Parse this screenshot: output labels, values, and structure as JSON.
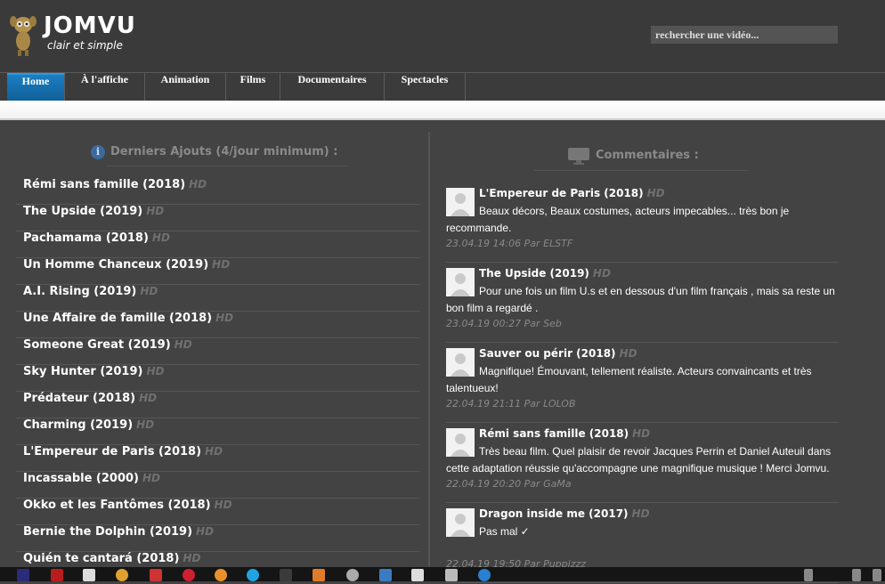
{
  "header": {
    "title": "JOMVU",
    "tagline": "clair et simple",
    "search_placeholder": "rechercher une vidéo..."
  },
  "nav": {
    "items": [
      "Home",
      "À l'affiche",
      "Animation",
      "Films",
      "Documentaires",
      "Spectacles"
    ],
    "active": "Home"
  },
  "latest": {
    "heading": "Derniers Ajouts (4/jour minimum) :",
    "badge": "HD",
    "items": [
      "Rémi sans famille (2018)",
      "The Upside (2019)",
      "Pachamama (2018)",
      "Un Homme Chanceux (2019)",
      "A.I. Rising (2019)",
      "Une Affaire de famille (2018)",
      "Someone Great (2019)",
      "Sky Hunter (2019)",
      "Prédateur (2018)",
      "Charming (2019)",
      "L'Empereur de Paris (2018)",
      "Incassable (2000)",
      "Okko et les Fantômes (2018)",
      "Bernie the Dolphin (2019)",
      "Quién te cantará (2018)"
    ]
  },
  "comments": {
    "heading": "Commentaires :",
    "badge": "HD",
    "items": [
      {
        "title": "L'Empereur de Paris (2018)",
        "text": "Beaux décors, Beaux costumes, acteurs impecables... très bon je recommande.",
        "meta": "23.04.19 14:06 Par ELSTF"
      },
      {
        "title": "The Upside (2019)",
        "text": "Pour une fois un film U.s et en dessous d'un film français , mais sa reste un bon film a regardé .",
        "meta": "23.04.19 00:27 Par Seb"
      },
      {
        "title": "Sauver ou périr (2018)",
        "text": "Magnifique! Émouvant, tellement réaliste. Acteurs convaincants et très talentueux!",
        "meta": "22.04.19 21:11 Par LOLOB"
      },
      {
        "title": "Rémi sans famille (2018)",
        "text": "Très beau film. Quel plaisir de revoir Jacques Perrin et Daniel Auteuil dans cette adaptation réussie qu'accompagne une magnifique musique ! Merci Jomvu.",
        "meta": "22.04.19 20:20 Par GaMa"
      },
      {
        "title": "Dragon inside me (2017)",
        "text": "Pas mal ✓",
        "meta": "22.04.19 19:50 Par Puppizzz"
      }
    ]
  },
  "colors": {
    "background": "#434343",
    "header": "#3a3a3a",
    "nav_active": "#1c7fc4",
    "muted": "#8a8a8a"
  },
  "icons": [
    "mascot-logo-icon",
    "info-icon",
    "comment-monitor-icon",
    "avatar-placeholder-icon"
  ]
}
